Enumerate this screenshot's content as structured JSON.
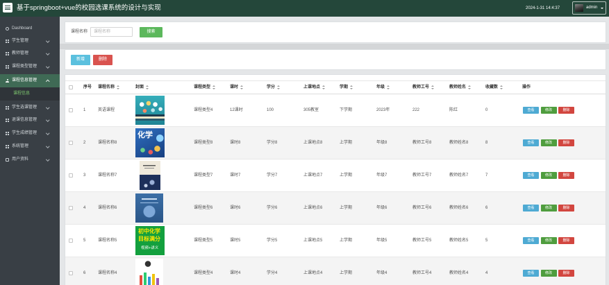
{
  "theme": {
    "header": "#24473a",
    "sidebar": "#393f45",
    "active": "#3f6a55",
    "sub_bg": "#2f3439",
    "sub_text": "#7cc46e",
    "info": "#5bc0de",
    "success": "#5cb85c",
    "danger": "#d9534f"
  },
  "header": {
    "menu_icon": "hamburger-icon",
    "title": "基于springboot+vue的校园选课系统的设计与实现",
    "datetime": "2024-1-31 14:4:37",
    "user": "admin"
  },
  "sidebar": {
    "items": [
      {
        "label": "Dashboard",
        "icon": "dashboard-icon"
      },
      {
        "label": "学生管理",
        "icon": "grid-icon",
        "expandable": true
      },
      {
        "label": "教师管理",
        "icon": "grid-icon",
        "expandable": true
      },
      {
        "label": "课程类型管理",
        "icon": "grid-icon",
        "expandable": true
      },
      {
        "label": "课程信息管理",
        "icon": "user-icon",
        "expandable": true,
        "expanded": true,
        "active": true,
        "children": [
          {
            "label": "课程信息",
            "active": true
          }
        ]
      },
      {
        "label": "学生选课管理",
        "icon": "grid-icon",
        "expandable": true
      },
      {
        "label": "退课信息管理",
        "icon": "grid-icon",
        "expandable": true
      },
      {
        "label": "学生成绩管理",
        "icon": "grid-icon",
        "expandable": true
      },
      {
        "label": "系统管理",
        "icon": "grid-icon",
        "expandable": true
      },
      {
        "label": "用户资料",
        "icon": "card-icon",
        "expandable": true
      }
    ]
  },
  "search": {
    "label": "课程名称",
    "placeholder": "课程名称",
    "button": "搜索"
  },
  "actions": {
    "add": "新增",
    "delete": "删除"
  },
  "table": {
    "columns": [
      {
        "label": "序号",
        "sortable": false
      },
      {
        "label": "课程名称",
        "sortable": true
      },
      {
        "label": "封面",
        "sortable": true
      },
      {
        "label": "课程类型",
        "sortable": true
      },
      {
        "label": "课时",
        "sortable": true
      },
      {
        "label": "学分",
        "sortable": true
      },
      {
        "label": "上课地点",
        "sortable": true
      },
      {
        "label": "学期",
        "sortable": true
      },
      {
        "label": "年级",
        "sortable": true
      },
      {
        "label": "教师工号",
        "sortable": true
      },
      {
        "label": "教师姓名",
        "sortable": true
      },
      {
        "label": "收藏数",
        "sortable": true
      },
      {
        "label": "操作",
        "sortable": false
      }
    ],
    "row_actions": {
      "view": "查看",
      "edit": "修改",
      "delete": "删除"
    },
    "rows": [
      {
        "index": "1",
        "name": "英语课程",
        "cover": {
          "kind": "english-books-cover",
          "text": []
        },
        "type": "课程类型4",
        "hours": "12课时",
        "credit": "100",
        "location": "305教室",
        "semester": "下学期",
        "grade": "2023年",
        "teacher_id": "222",
        "teacher_name": "陈红",
        "favorites": "0"
      },
      {
        "index": "2",
        "name": "课程名称8",
        "cover": {
          "kind": "chemistry-blue-cover",
          "text": [
            "化学"
          ]
        },
        "type": "课程类型8",
        "hours": "课时8",
        "credit": "学分8",
        "location": "上课地点8",
        "semester": "上学期",
        "grade": "年级8",
        "teacher_id": "教师工号8",
        "teacher_name": "教师姓名8",
        "favorites": "8"
      },
      {
        "index": "3",
        "name": "课程名称7",
        "cover": {
          "kind": "book-beige-cover",
          "text": []
        },
        "type": "课程类型7",
        "hours": "课时7",
        "credit": "学分7",
        "location": "上课地点7",
        "semester": "上学期",
        "grade": "年级7",
        "teacher_id": "教师工号7",
        "teacher_name": "教师姓名7",
        "favorites": "7"
      },
      {
        "index": "4",
        "name": "课程名称6",
        "cover": {
          "kind": "book-blue-cover",
          "text": []
        },
        "type": "课程类型6",
        "hours": "课时6",
        "credit": "学分6",
        "location": "上课地点6",
        "semester": "上学期",
        "grade": "年级6",
        "teacher_id": "教师工号6",
        "teacher_name": "教师姓名6",
        "favorites": "6"
      },
      {
        "index": "5",
        "name": "课程名称5",
        "cover": {
          "kind": "chemistry-green-cover",
          "text": [
            "初中化学",
            "目标满分",
            "视频+讲义"
          ]
        },
        "type": "课程类型5",
        "hours": "课时5",
        "credit": "学分5",
        "location": "上课地点5",
        "semester": "上学期",
        "grade": "年级5",
        "teacher_id": "教师工号5",
        "teacher_name": "教师姓名5",
        "favorites": "5"
      },
      {
        "index": "6",
        "name": "课程名称4",
        "cover": {
          "kind": "colorful-cover",
          "text": []
        },
        "type": "课程类型4",
        "hours": "课时4",
        "credit": "学分4",
        "location": "上课地点4",
        "semester": "上学期",
        "grade": "年级4",
        "teacher_id": "教师工号4",
        "teacher_name": "教师姓名4",
        "favorites": "4"
      }
    ]
  }
}
